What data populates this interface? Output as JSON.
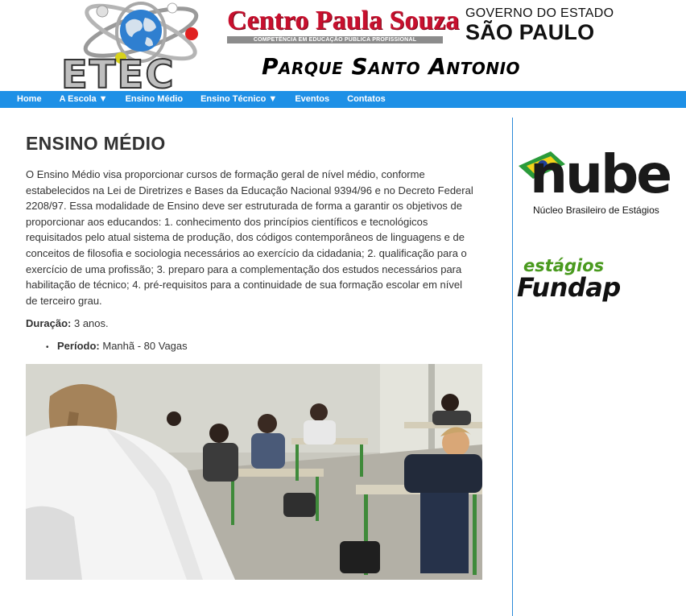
{
  "header": {
    "etec_logo_text": "ETEC",
    "cps_title_part1": "Centro",
    "cps_title_part2": "Paula",
    "cps_title_part3": "Souza",
    "cps_subtitle": "COMPETÊNCIA EM EDUCAÇÃO PÚBLICA PROFISSIONAL",
    "gov_top": "GOVERNO DO ESTADO",
    "gov_bottom": "SÃO PAULO",
    "campus_name": "Parque Santo Antonio"
  },
  "nav": {
    "items": [
      {
        "label": "Home"
      },
      {
        "label": "A Escola ▼"
      },
      {
        "label": "Ensino Médio"
      },
      {
        "label": "Ensino Técnico ▼"
      },
      {
        "label": "Eventos"
      },
      {
        "label": "Contatos"
      }
    ]
  },
  "main": {
    "title": "ENSINO MÉDIO",
    "intro": "O Ensino Médio visa proporcionar cursos de formação geral de nível médio, conforme estabelecidos na Lei de Diretrizes e Bases da Educação Nacional 9394/96 e no Decreto Federal 2208/97. Essa modalidade de Ensino deve ser estruturada de forma a garantir os objetivos de proporcionar aos educandos: 1. conhecimento dos princípios científicos e tecnológicos requisitados pelo atual sistema de produção, dos códigos contemporâneos de linguagens e de conceitos de filosofia e sociologia necessários ao exercício da cidadania; 2. qualificação para o exercício de uma profissão; 3. preparo para a complementação dos estudos necessários  para  habilitação de técnico; 4. pré-requisitos para a continuidade de sua formação escolar em nível de terceiro grau.",
    "duration_label": "Duração:",
    "duration_value": "3 anos.",
    "periodo_bullet": "•",
    "periodo_label": "Período:",
    "periodo_value": "Manhã - 80 Vagas"
  },
  "sidebar": {
    "nube_word": "nube",
    "nube_sub": "Núcleo Brasileiro de Estágios",
    "fundap_top": "estágios",
    "fundap_bottom": "Fundap"
  },
  "colors": {
    "nav_bg": "#1e90e6",
    "cps_red": "#c8102e",
    "fundap_green": "#4a9a1f",
    "divider": "#2b8ad8"
  }
}
